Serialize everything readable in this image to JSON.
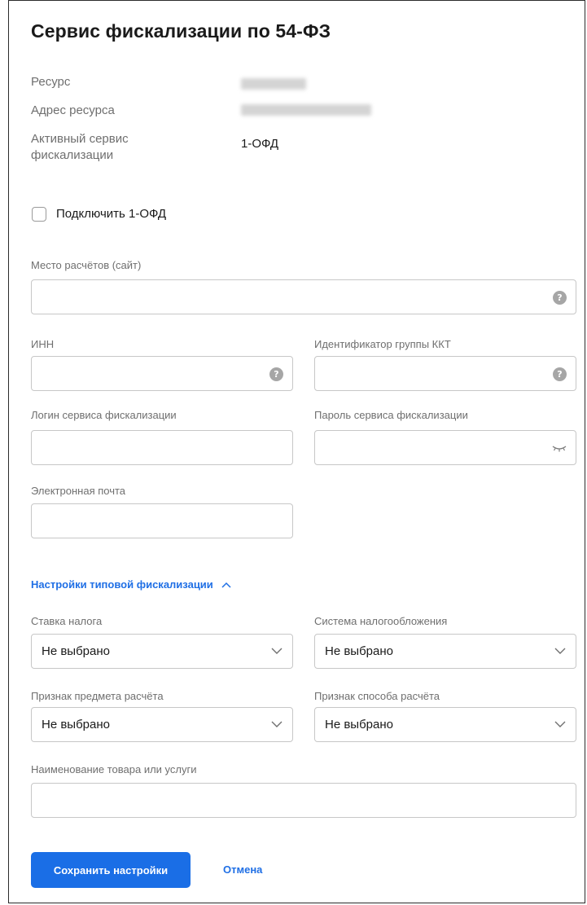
{
  "page": {
    "title": "Сервис фискализации по 54-ФЗ"
  },
  "info": {
    "resource_label": "Ресурс",
    "address_label": "Адрес ресурса",
    "active_service_label_line1": "Активный сервис",
    "active_service_label_line2": "фискализации",
    "active_service_value": "1-ОФД"
  },
  "connect": {
    "label": "Подключить 1-ОФД",
    "checked": false
  },
  "fields": {
    "place": {
      "label": "Место расчётов (сайт)",
      "value": "",
      "help": "?"
    },
    "inn": {
      "label": "ИНН",
      "value": "",
      "help": "?"
    },
    "kkt_group": {
      "label": "Идентификатор группы ККТ",
      "value": "",
      "help": "?"
    },
    "login": {
      "label": "Логин сервиса фискализации",
      "value": ""
    },
    "password": {
      "label": "Пароль сервиса фискализации",
      "value": ""
    },
    "email": {
      "label": "Электронная почта",
      "value": ""
    },
    "product_name": {
      "label": "Наименование товара или услуги",
      "value": ""
    }
  },
  "typical": {
    "toggle_label": "Настройки типовой фискализации",
    "tax_rate": {
      "label": "Ставка налога",
      "selected": "Не выбрано"
    },
    "tax_system": {
      "label": "Система налогообложения",
      "selected": "Не выбрано"
    },
    "subject": {
      "label": "Признак предмета расчёта",
      "selected": "Не выбрано"
    },
    "method": {
      "label": "Признак способа расчёта",
      "selected": "Не выбрано"
    }
  },
  "actions": {
    "save_label": "Сохранить настройки",
    "cancel_label": "Отмена"
  },
  "colors": {
    "accent": "#1a6ee6",
    "link": "#1f6fe5",
    "border": "#c7c7c7"
  }
}
